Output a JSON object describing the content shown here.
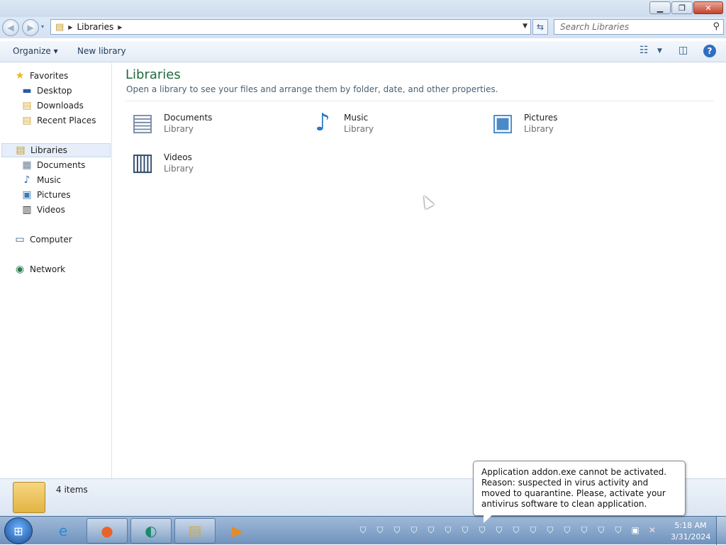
{
  "window": {
    "address": {
      "root_label": "Libraries"
    },
    "search": {
      "placeholder": "Search Libraries"
    },
    "toolbar": {
      "organize": "Organize ▾",
      "new_library": "New library"
    }
  },
  "sidebar": {
    "favorites": {
      "label": "Favorites",
      "items": [
        {
          "label": "Desktop"
        },
        {
          "label": "Downloads"
        },
        {
          "label": "Recent Places"
        }
      ]
    },
    "libraries": {
      "label": "Libraries",
      "items": [
        {
          "label": "Documents"
        },
        {
          "label": "Music"
        },
        {
          "label": "Pictures"
        },
        {
          "label": "Videos"
        }
      ]
    },
    "computer": {
      "label": "Computer"
    },
    "network": {
      "label": "Network"
    }
  },
  "main": {
    "title": "Libraries",
    "description": "Open a library to see your files and arrange them by folder, date, and other properties.",
    "libraries": [
      {
        "name": "Documents",
        "type": "Library",
        "icon": "documents-library-icon"
      },
      {
        "name": "Music",
        "type": "Library",
        "icon": "music-library-icon"
      },
      {
        "name": "Pictures",
        "type": "Library",
        "icon": "pictures-library-icon"
      },
      {
        "name": "Videos",
        "type": "Library",
        "icon": "videos-library-icon"
      }
    ]
  },
  "status": {
    "item_count": "4 items"
  },
  "notification": {
    "message": "Application addon.exe cannot be activated. Reason: suspected in virus activity and moved to quarantine. Please, activate your antivirus software to clean application."
  },
  "taskbar": {
    "apps": [
      "internet-explorer-icon",
      "firefox-icon",
      "app-icon",
      "explorer-icon",
      "media-player-icon"
    ],
    "clock": {
      "time": "5:18 AM",
      "date": "3/31/2024"
    }
  }
}
